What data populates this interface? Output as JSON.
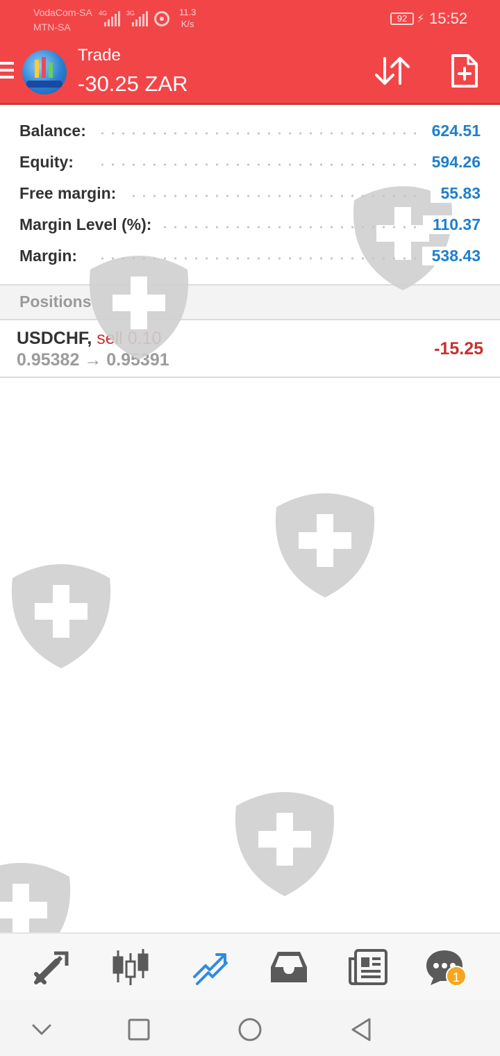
{
  "status_bar": {
    "carrier_1": "VodaCom-SA",
    "carrier_2": "MTN-SA",
    "net_1": "4G",
    "net_2": "3G",
    "speed_value": "11.3",
    "speed_unit": "K/s",
    "battery": "92",
    "time": "15:52"
  },
  "header": {
    "title": "Trade",
    "profit": "-30.25 ZAR",
    "accent_color": "#f24548"
  },
  "account": {
    "rows": [
      {
        "label": "Balance:",
        "value": "624.51"
      },
      {
        "label": "Equity:",
        "value": "594.26"
      },
      {
        "label": "Free margin:",
        "value": "55.83"
      },
      {
        "label": "Margin Level (%):",
        "value": "110.37"
      },
      {
        "label": "Margin:",
        "value": "538.43"
      }
    ]
  },
  "positions": {
    "header": "Positions",
    "items": [
      {
        "symbol": "USDCHF,",
        "side": "sell 0.10",
        "prices": "0.95382 → 0.95391",
        "profit": "-15.25"
      }
    ]
  },
  "tabbar": {
    "tabs": [
      "quotes-icon",
      "chart-icon",
      "trade-icon",
      "history-icon",
      "news-icon",
      "chat-icon"
    ],
    "active": "trade-icon",
    "chat_badge": "1"
  },
  "navbar": {
    "buttons": [
      "collapse-icon",
      "recents-icon",
      "home-icon",
      "back-icon"
    ]
  }
}
